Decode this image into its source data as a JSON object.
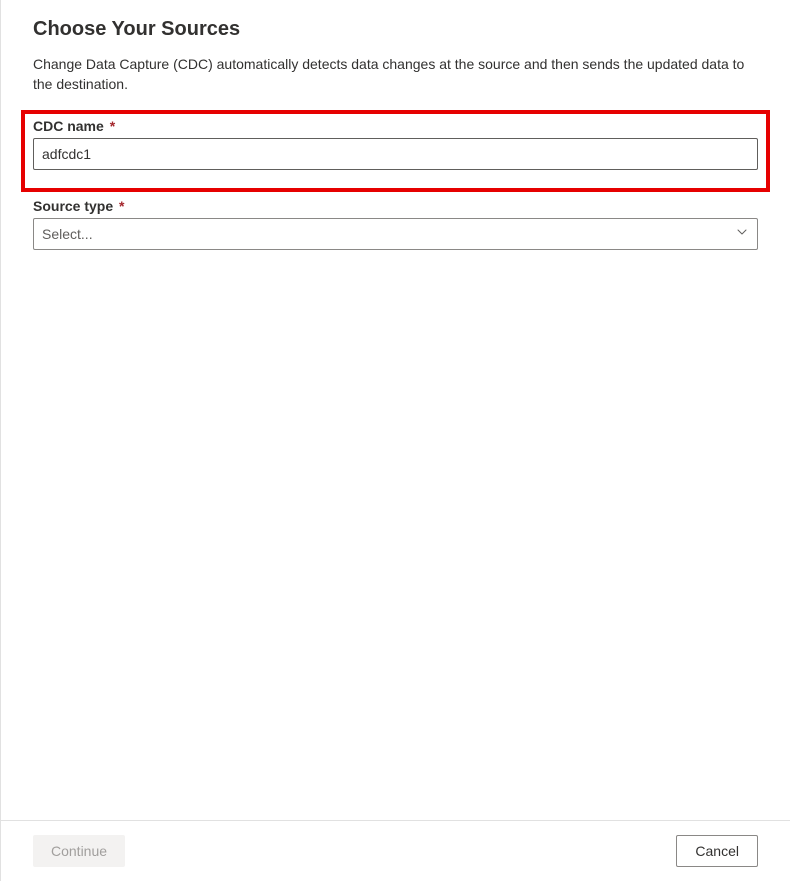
{
  "header": {
    "title": "Choose Your Sources",
    "description": "Change Data Capture (CDC) automatically detects data changes at the source and then sends the updated data to the destination."
  },
  "form": {
    "cdc_name": {
      "label": "CDC name",
      "value": "adfcdc1",
      "required_marker": "*"
    },
    "source_type": {
      "label": "Source type",
      "placeholder": "Select...",
      "required_marker": "*"
    }
  },
  "footer": {
    "continue_label": "Continue",
    "cancel_label": "Cancel"
  }
}
